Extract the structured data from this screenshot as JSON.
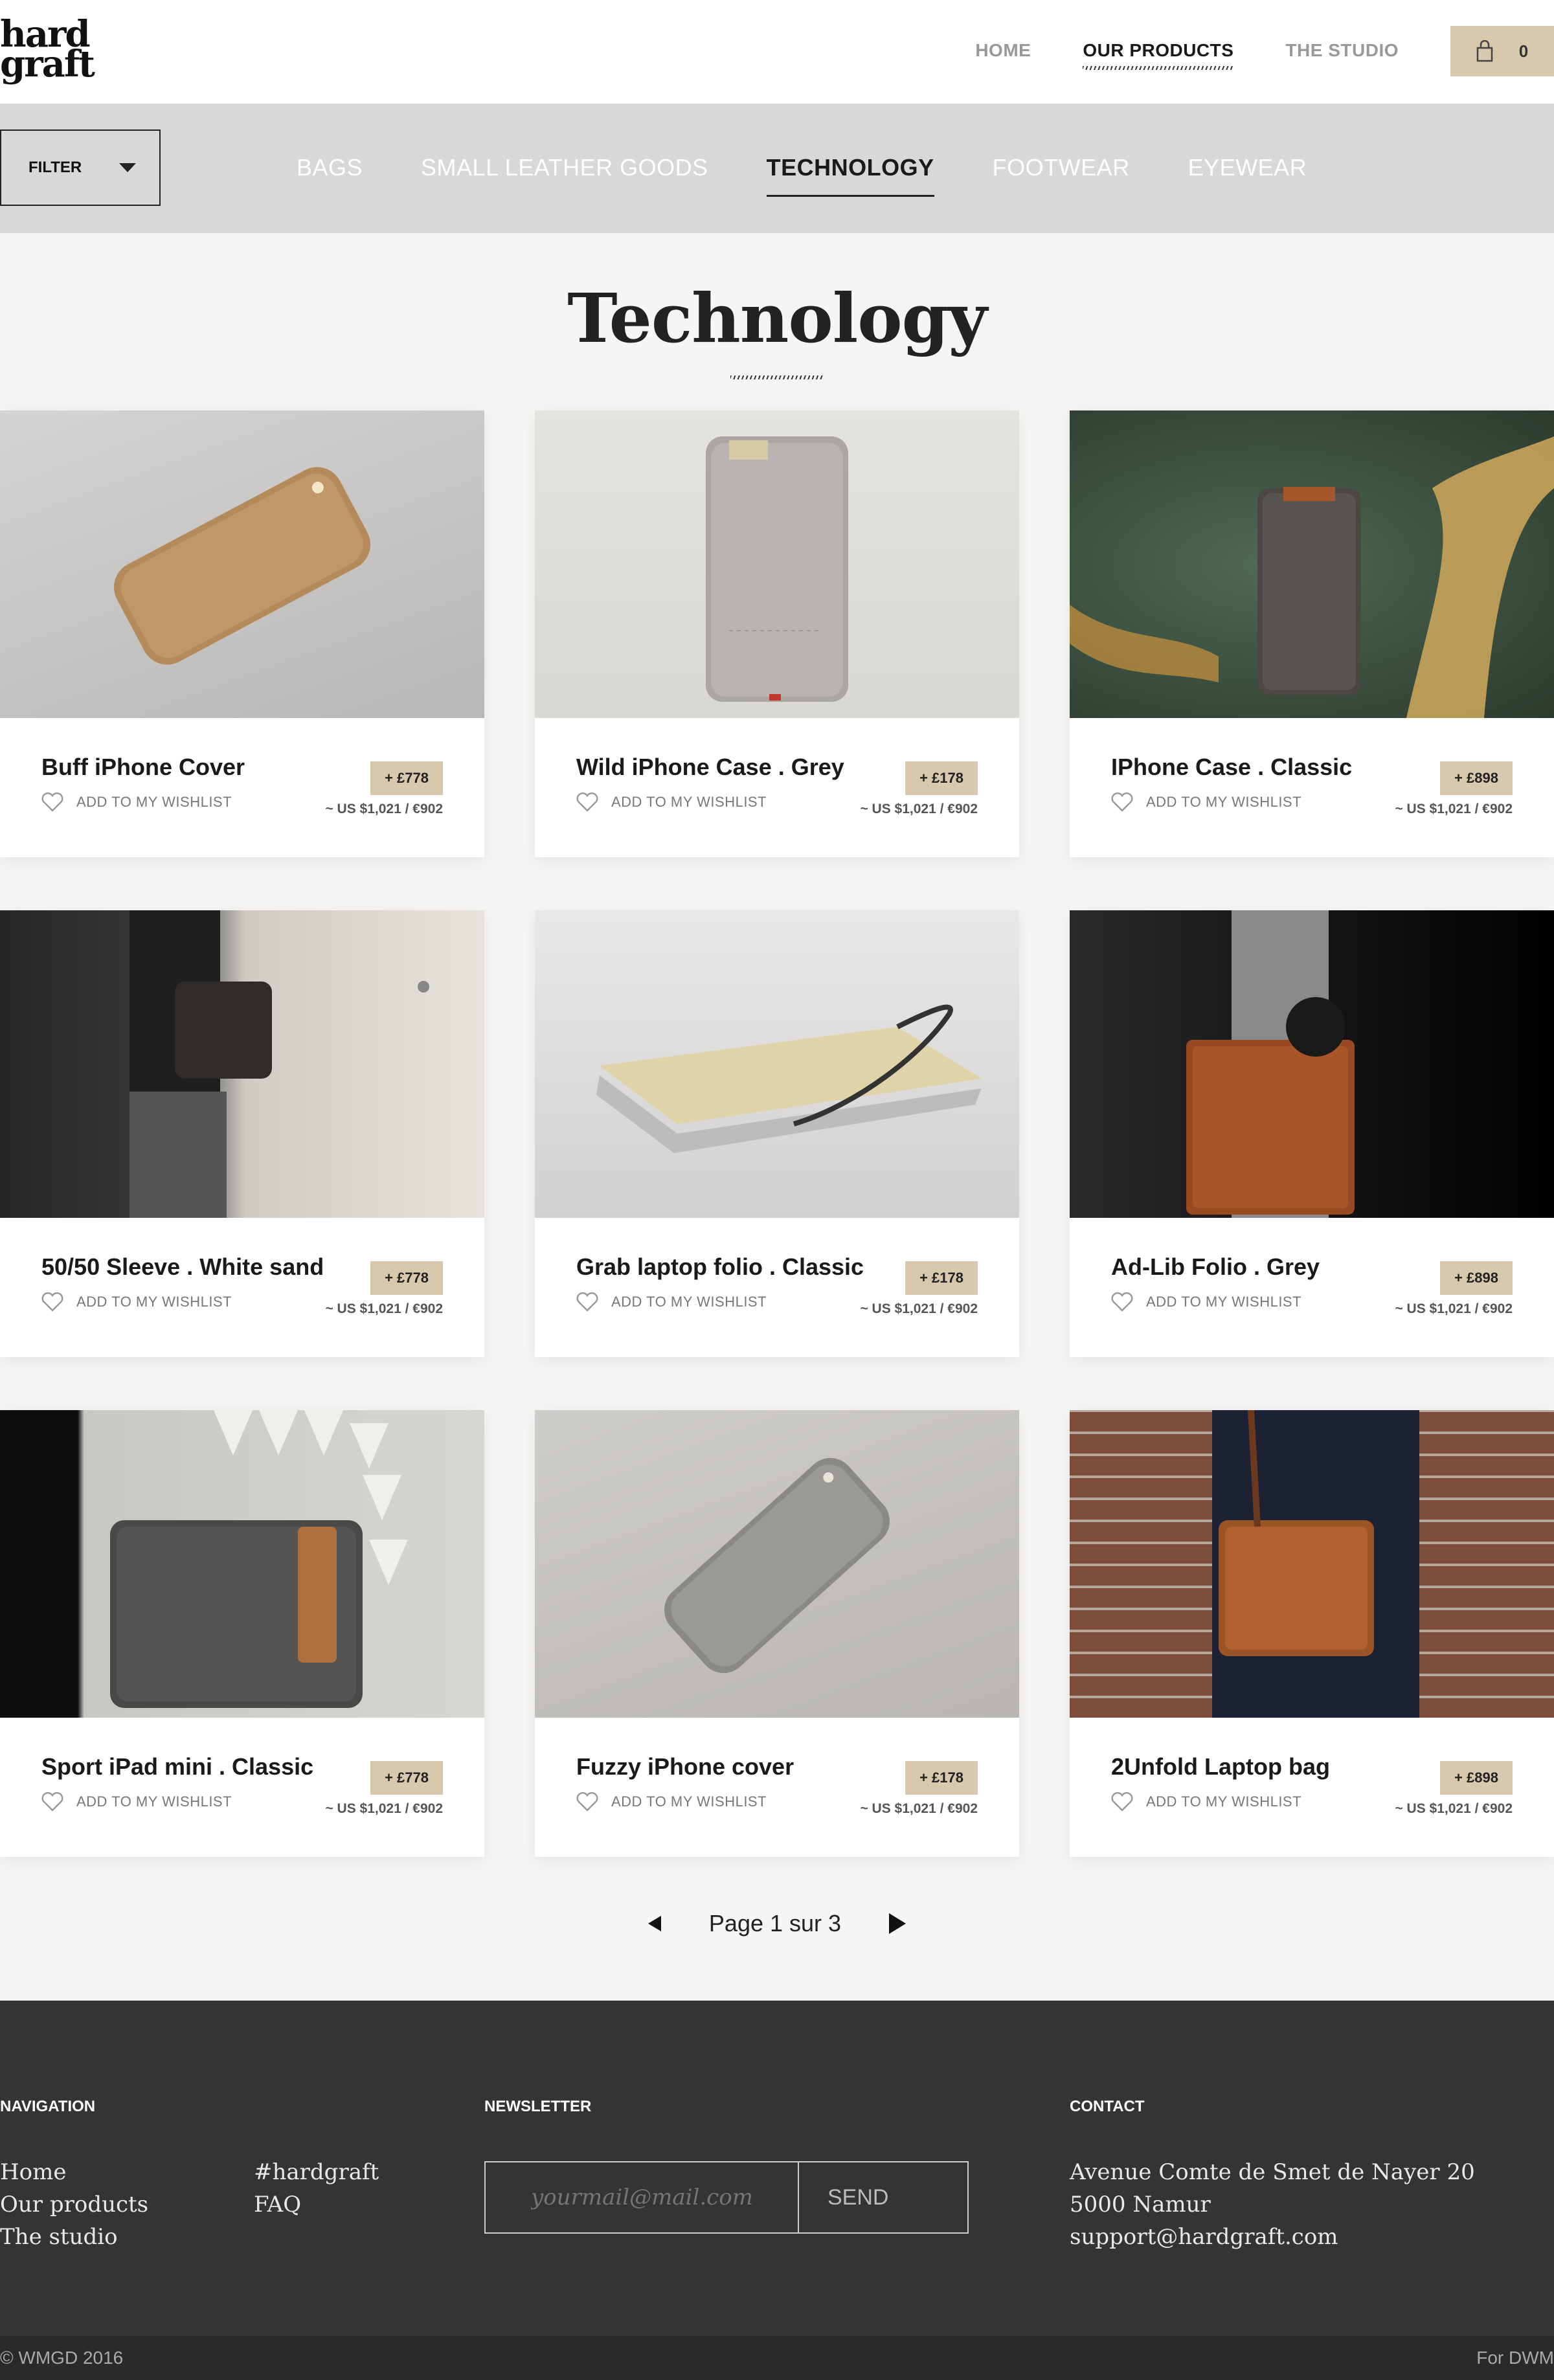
{
  "header": {
    "logo_line1": "hard",
    "logo_line2": "graft",
    "nav": [
      {
        "label": "HOME"
      },
      {
        "label": "OUR PRODUCTS"
      },
      {
        "label": "THE STUDIO"
      }
    ],
    "cart_count": "0"
  },
  "catbar": {
    "filter_label": "FILTER",
    "categories": [
      {
        "label": "BAGS"
      },
      {
        "label": "SMALL LEATHER GOODS"
      },
      {
        "label": "TECHNOLOGY"
      },
      {
        "label": "FOOTWEAR"
      },
      {
        "label": "EYEWEAR"
      }
    ]
  },
  "page_title": "Technology",
  "wishlist_label": "ADD TO MY WISHLIST",
  "products": [
    {
      "name": "Buff iPhone Cover",
      "price": "+ £778",
      "alt_price": "~ US $1,021 / €902"
    },
    {
      "name": "Wild iPhone Case . Grey",
      "price": "+ £178",
      "alt_price": "~ US $1,021 / €902"
    },
    {
      "name": "IPhone Case . Classic",
      "price": "+ £898",
      "alt_price": "~ US $1,021 / €902"
    },
    {
      "name": "50/50 Sleeve . White sand",
      "price": "+ £778",
      "alt_price": "~ US $1,021 / €902"
    },
    {
      "name": "Grab laptop folio . Classic",
      "price": "+ £178",
      "alt_price": "~ US $1,021 / €902"
    },
    {
      "name": "Ad-Lib Folio . Grey",
      "price": "+ £898",
      "alt_price": "~ US $1,021 / €902"
    },
    {
      "name": "Sport iPad mini . Classic",
      "price": "+ £778",
      "alt_price": "~ US $1,021 / €902"
    },
    {
      "name": "Fuzzy iPhone cover",
      "price": "+ £178",
      "alt_price": "~ US $1,021 / €902"
    },
    {
      "name": "2Unfold Laptop bag",
      "price": "+ £898",
      "alt_price": "~ US $1,021 / €902"
    }
  ],
  "pager": {
    "label": "Page 1 sur 3"
  },
  "footer": {
    "nav_heading": "NAVIGATION",
    "nav_col1": [
      "Home",
      "Our products",
      "The studio"
    ],
    "nav_col2": [
      "#hardgraft",
      "FAQ"
    ],
    "newsletter_heading": "NEWSLETTER",
    "newsletter_placeholder": "yourmail@mail.com",
    "newsletter_send": "SEND",
    "contact_heading": "CONTACT",
    "contact_address": "Avenue Comte de Smet de Nayer 20 5000 Namur",
    "contact_email": "support@hardgraft.com",
    "copyright": "© WMGD 2016",
    "credit": "For DWM"
  },
  "colors": {
    "accent": "#d8c8ae",
    "catbar": "#d8d8d8",
    "footer": "#343434",
    "background": "#f6f5f3"
  }
}
